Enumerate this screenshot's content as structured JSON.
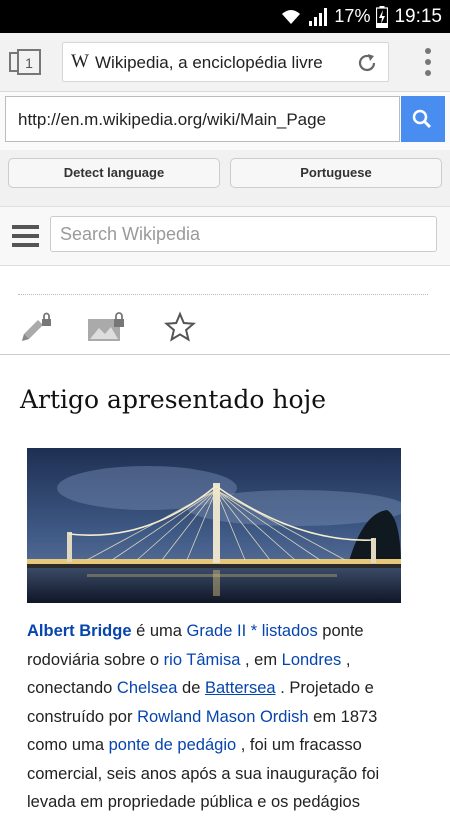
{
  "status_bar": {
    "battery": "17%",
    "time": "19:15",
    "icons": [
      "wifi-icon",
      "signal-icon",
      "battery-charging-icon"
    ]
  },
  "browser": {
    "tab_count": "1",
    "page_title": "Wikipedia, a enciclopédia livre",
    "url": "http://en.m.wikipedia.org/wiki/Main_Page",
    "accent_color": "#4a8df0"
  },
  "translate_bar": {
    "source_button": "Detect language",
    "target_button": "Portuguese"
  },
  "wiki_header": {
    "search_placeholder": "Search Wikipedia"
  },
  "page_actions": [
    "edit-locked-icon",
    "image-locked-icon",
    "star-icon"
  ],
  "section": {
    "heading": "Artigo apresentado hoje"
  },
  "article": {
    "title_link": "Albert Bridge",
    "t1": " é uma ",
    "grade_link": "Grade II * listados",
    "t2": " ponte rodoviária sobre o ",
    "river_link": "rio Tâmisa",
    "t3": " , em ",
    "london_link": "Londres",
    "t4": " , conectando ",
    "chelsea_link": "Chelsea",
    "t5": " de ",
    "battersea_link": "Battersea",
    "t6": " . Projetado e construído por ",
    "ordish_link": "Rowland Mason Ordish",
    "t7": " em 1873 como uma ",
    "toll_link": "ponte de pedágio",
    "t8": " , foi um fracasso comercial, seis anos após a sua inauguração foi levada em propriedade pública e os pedágios"
  }
}
